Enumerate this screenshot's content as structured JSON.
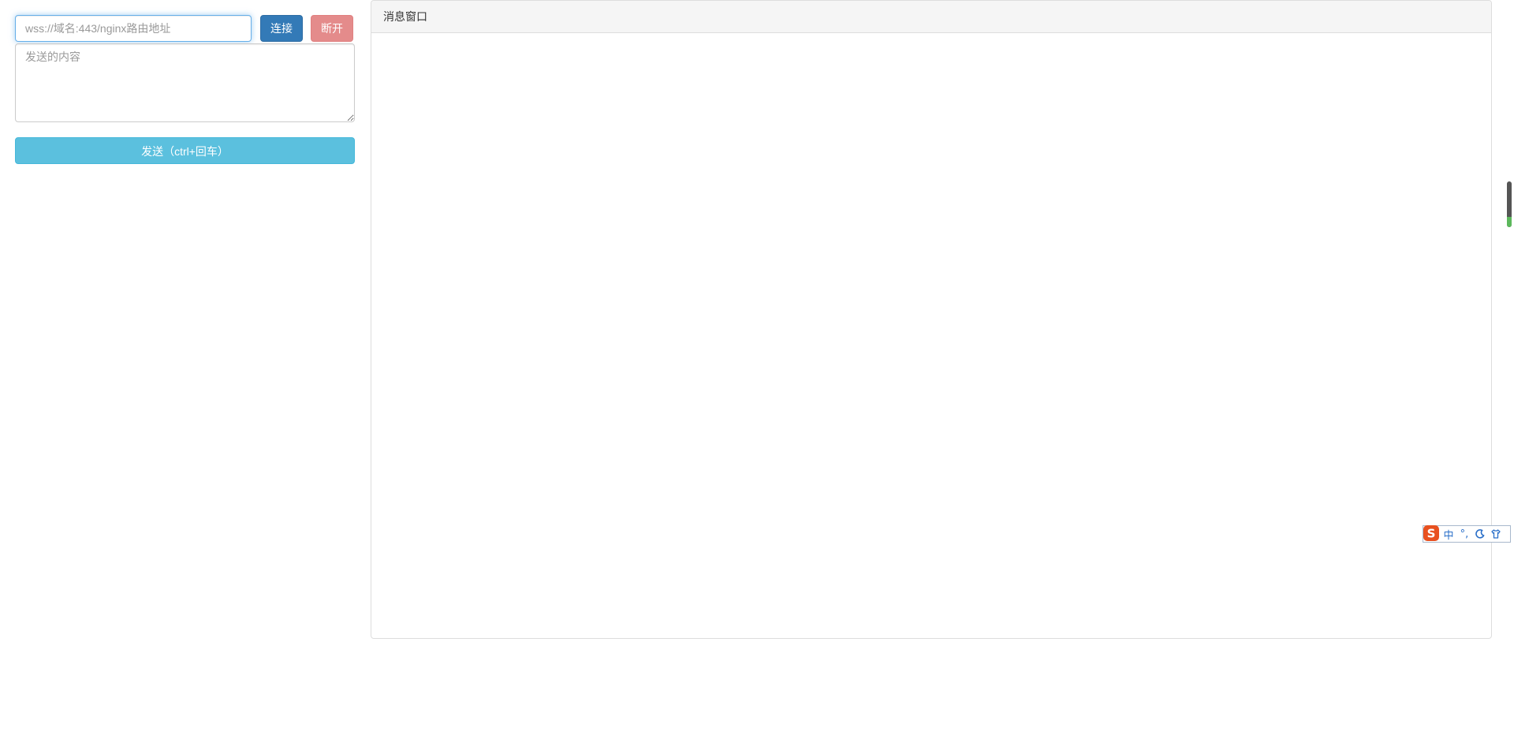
{
  "connection": {
    "url_placeholder": "wss://域名:443/nginx路由地址",
    "url_value": "",
    "connect_label": "连接",
    "disconnect_label": "断开"
  },
  "composer": {
    "content_placeholder": "发送的内容",
    "send_label": "发送（ctrl+回车）"
  },
  "message_window": {
    "title": "消息窗口"
  },
  "ime_toolbar": {
    "mode_label": "中",
    "punct_label": "°,",
    "icons": [
      "sogou-logo-icon",
      "moon-icon",
      "shirt-icon"
    ]
  },
  "scroll_indicator": {
    "level_fraction": 0.22
  },
  "colors": {
    "connect": "#337ab7",
    "disconnect": "#e48b8b",
    "send": "#5bc0de",
    "focus_border": "#66afe9",
    "panel_heading_bg": "#f5f5f5",
    "ime_logo": "#e8501f",
    "ime_icon": "#2a6fc9"
  }
}
